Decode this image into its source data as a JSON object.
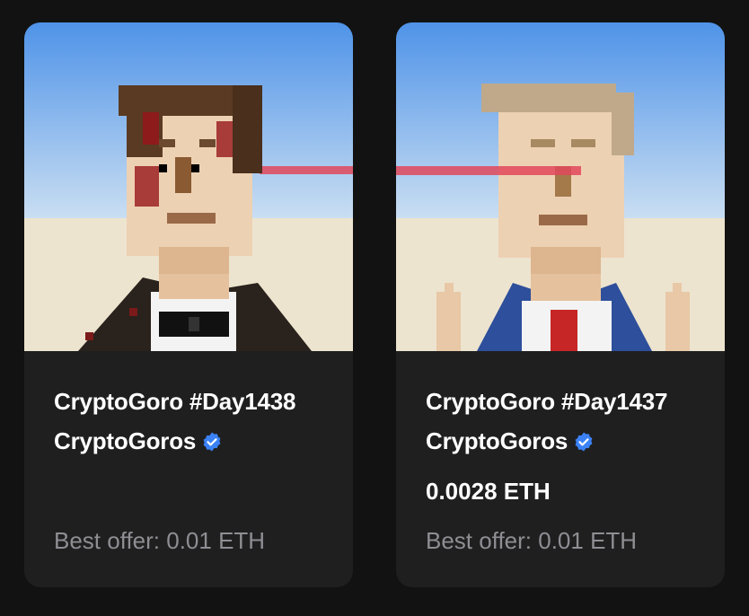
{
  "cards": [
    {
      "title": "CryptoGoro #Day1438",
      "collection": "CryptoGoros",
      "price": "",
      "best_offer": "Best offer: 0.01 ETH",
      "verified_icon": "verified-badge-icon"
    },
    {
      "title": "CryptoGoro #Day1437",
      "collection": "CryptoGoros",
      "price": "0.0028 ETH",
      "best_offer": "Best offer: 0.01 ETH",
      "verified_icon": "verified-badge-icon"
    }
  ],
  "colors": {
    "page_bg": "#121212",
    "card_bg": "#1f1f20",
    "muted_text": "#8e8e93",
    "verified_blue": "#3b82f6",
    "laser_red": "#e0485a"
  }
}
